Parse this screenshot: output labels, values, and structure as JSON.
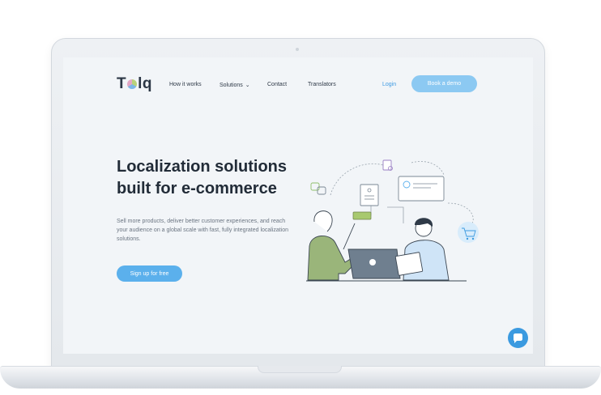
{
  "nav": {
    "logo": "Tolq",
    "logo_prefix": "T",
    "logo_suffix": "lq",
    "links": [
      "How it works",
      "Solutions",
      "Contact",
      "Translators"
    ],
    "login": "Login",
    "book_demo": "Book a demo"
  },
  "hero": {
    "title_line1": "Localization solutions",
    "title_line2": "built for e-commerce",
    "description": "Sell more products, deliver better customer experiences, and reach your audience on a global scale with fast, fully integrated localization solutions.",
    "cta": "Sign up for free"
  },
  "colors": {
    "accent": "#5bb0ec",
    "accent_light": "#8cc9f2",
    "text_dark": "#222c38"
  },
  "icons": [
    "chevron-down-icon",
    "chat-icon",
    "translate-icon",
    "document-icon",
    "cart-icon"
  ]
}
